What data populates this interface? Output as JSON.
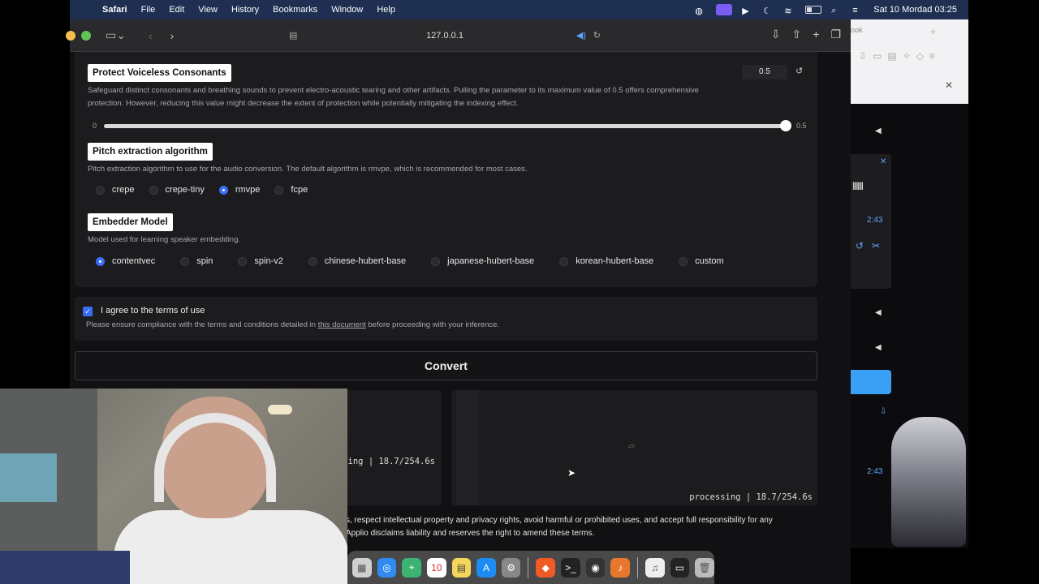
{
  "menubar": {
    "app": "Safari",
    "items": [
      "File",
      "Edit",
      "View",
      "History",
      "Bookmarks",
      "Window",
      "Help"
    ],
    "datetime": "Sat 10 Mordad 03:25"
  },
  "browser": {
    "url": "127.0.0.1"
  },
  "protect": {
    "label": "Protect Voiceless Consonants",
    "description": "Safeguard distinct consonants and breathing sounds to prevent electro-acoustic tearing and other artifacts. Pulling the parameter to its maximum value of 0.5 offers comprehensive protection. However, reducing this value might decrease the extent of protection while potentially mitigating the indexing effect.",
    "value": "0.5",
    "min_label": "0",
    "max_label": "0.5",
    "fraction": 1.0
  },
  "pitch": {
    "label": "Pitch extraction algorithm",
    "description": "Pitch extraction algorithm to use for the audio conversion. The default algorithm is rmvpe, which is recommended for most cases.",
    "options": [
      "crepe",
      "crepe-tiny",
      "rmvpe",
      "fcpe"
    ],
    "selected": "rmvpe"
  },
  "embedder": {
    "label": "Embedder Model",
    "description": "Model used for learning speaker embedding.",
    "options": [
      "contentvec",
      "spin",
      "spin-v2",
      "chinese-hubert-base",
      "japanese-hubert-base",
      "korean-hubert-base",
      "custom"
    ],
    "selected": "contentvec"
  },
  "terms": {
    "agree_label": "I agree to the terms of use",
    "note_before": "Please ensure compliance with the terms and conditions detailed in ",
    "note_link": "this document",
    "note_after": " before proceeding with your inference."
  },
  "convert_label": "Convert",
  "outputs": {
    "left_status": "ing | 18.7/254.6s",
    "right_status": "processing | 18.7/254.6s"
  },
  "footer": {
    "line1": "s, respect intellectual property and privacy rights, avoid harmful or prohibited uses, and accept full responsibility for any",
    "line2": "Applio disclaims liability and reserves the right to amend these terms."
  },
  "sidewin": {
    "tab_fragment": "ook",
    "time1": "2:43",
    "time2": "2:43"
  },
  "colors": {
    "accent": "#3b6cf6",
    "menubar": "#1e2f52",
    "panel": "#1c1c1f"
  }
}
